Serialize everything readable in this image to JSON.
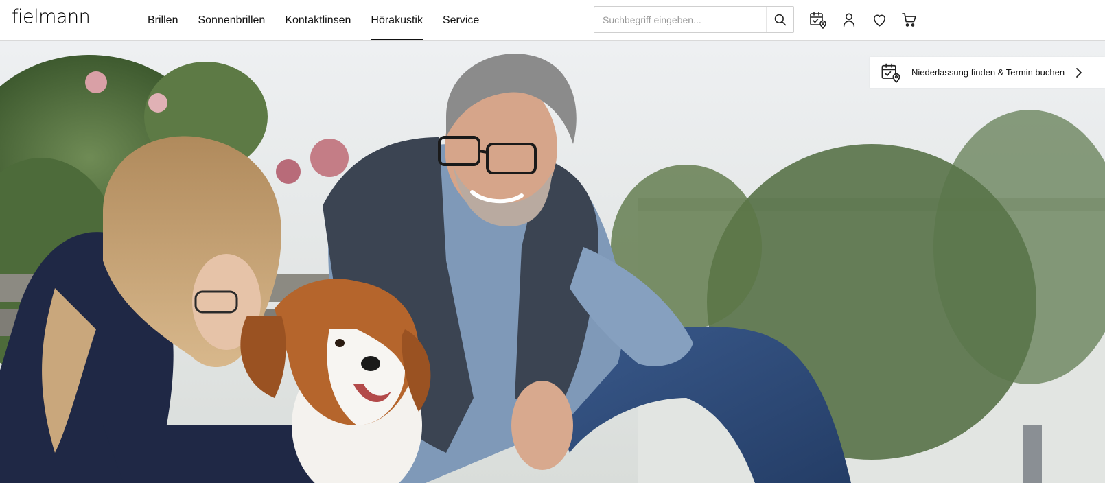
{
  "header": {
    "logo": "fielmann",
    "nav": [
      {
        "label": "Brillen",
        "active": false
      },
      {
        "label": "Sonnenbrillen",
        "active": false
      },
      {
        "label": "Kontaktlinsen",
        "active": false
      },
      {
        "label": "Hörakustik",
        "active": true
      },
      {
        "label": "Service",
        "active": false
      }
    ],
    "search": {
      "placeholder": "Suchbegriff eingeben...",
      "value": "",
      "icon": "search-icon"
    },
    "icons": [
      "calendar-location-icon",
      "user-icon",
      "heart-icon",
      "cart-icon"
    ]
  },
  "hero": {
    "image": "Outdoor photo: smiling man with glasses and quilted vest, girl with glasses, brown and white dog, garden background"
  },
  "branch_finder": {
    "label": "Niederlassung finden & Termin buchen",
    "icon": "calendar-location-icon",
    "chevron": "chevron-right-icon"
  },
  "colors": {
    "text": "#111111",
    "border": "#d9d9d9",
    "background": "#ffffff"
  }
}
